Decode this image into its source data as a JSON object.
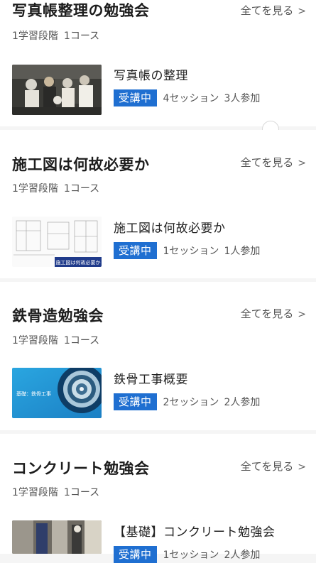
{
  "sections": [
    {
      "title": "写真帳整理の勉強会",
      "see_all": "全てを見る",
      "stage": "1学習段階",
      "courses_count": "1コース",
      "course": {
        "title": "写真帳の整理",
        "badge": "受講中",
        "sessions": "4セッション",
        "participants": "3人参加"
      }
    },
    {
      "title": "施工図は何故必要か",
      "see_all": "全てを見る",
      "stage": "1学習段階",
      "courses_count": "1コース",
      "course": {
        "title": "施工図は何故必要か",
        "badge": "受講中",
        "sessions": "1セッション",
        "participants": "1人参加",
        "thumb_caption": "施工図は何故必要か"
      }
    },
    {
      "title": "鉄骨造勉強会",
      "see_all": "全てを見る",
      "stage": "1学習段階",
      "courses_count": "1コース",
      "course": {
        "title": "鉄骨工事概要",
        "badge": "受講中",
        "sessions": "2セッション",
        "participants": "2人参加",
        "thumb_caption": "基礎：鉄骨工事"
      }
    },
    {
      "title": "コンクリート勉強会",
      "see_all": "全てを見る",
      "stage": "1学習段階",
      "courses_count": "1コース",
      "course": {
        "title": "【基礎】コンクリート勉強会",
        "badge": "受講中",
        "sessions": "1セッション",
        "participants": "2人参加"
      }
    }
  ],
  "icons": {
    "chevron": "chevron-right-icon"
  },
  "colors": {
    "badge": "#1f6fd1",
    "background": "#f5f5f5",
    "card": "#ffffff"
  }
}
